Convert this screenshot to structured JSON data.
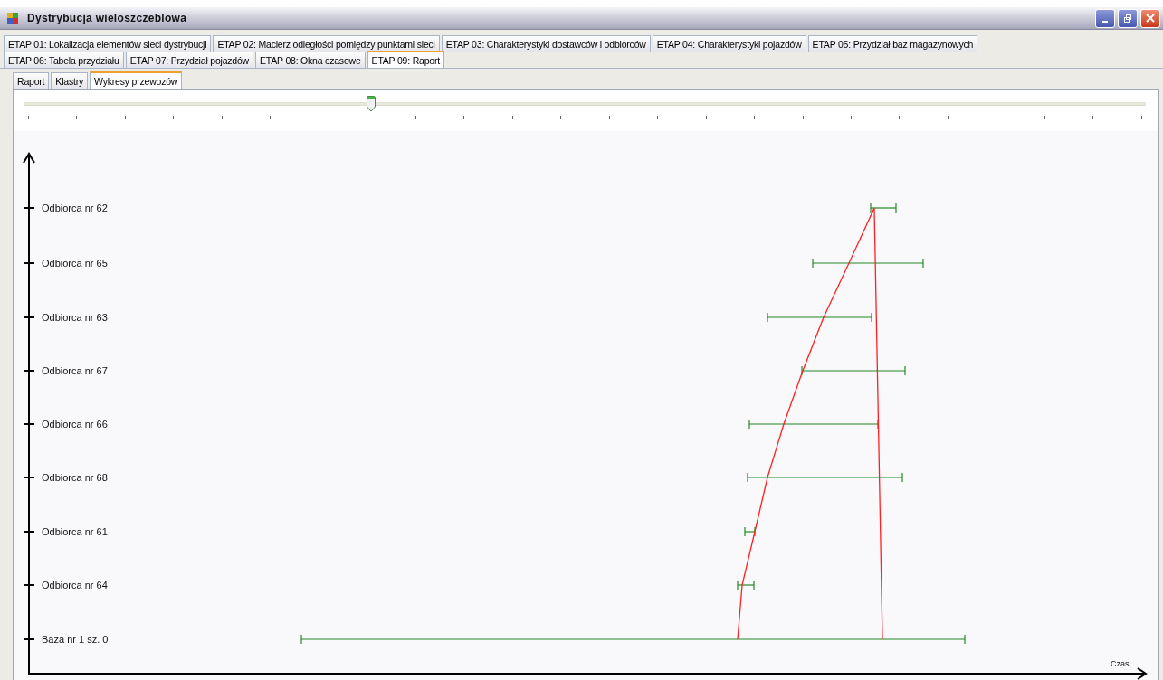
{
  "window": {
    "title": "Dystrybucja wieloszczeblowa"
  },
  "tab_rows": [
    {
      "tabs": [
        {
          "label": "ETAP 01: Lokalizacja elementów sieci dystrybucji",
          "selected": false
        },
        {
          "label": "ETAP 02: Macierz odległości pomiędzy punktami sieci",
          "selected": false
        },
        {
          "label": "ETAP 03: Charakterystyki dostawców i odbiorców",
          "selected": false
        },
        {
          "label": "ETAP 04: Charakterystyki pojazdów",
          "selected": false
        },
        {
          "label": "ETAP 05: Przydział baz magazynowych",
          "selected": false
        }
      ]
    },
    {
      "tabs": [
        {
          "label": "ETAP 06: Tabela przydziału",
          "selected": false
        },
        {
          "label": "ETAP 07: Przydział pojazdów",
          "selected": false
        },
        {
          "label": "ETAP 08: Okna czasowe",
          "selected": false
        },
        {
          "label": "ETAP 09: Raport",
          "selected": true
        }
      ]
    }
  ],
  "subtabs": [
    {
      "label": "Raport",
      "selected": false
    },
    {
      "label": "Klastry",
      "selected": false
    },
    {
      "label": "Wykresy przewozów",
      "selected": true
    }
  ],
  "slider": {
    "level": 0.305
  },
  "chart": {
    "rows": [
      "Odbiorca nr 62",
      "Odbiorca nr 65",
      "Odbiorca nr 63",
      "Odbiorca nr 67",
      "Odbiorca nr 66",
      "Odbiorca nr 68",
      "Odbiorca nr 61",
      "Odbiorca nr 64",
      "Baza nr 1 sz. 0"
    ],
    "x_axis_label": "Czas"
  }
}
